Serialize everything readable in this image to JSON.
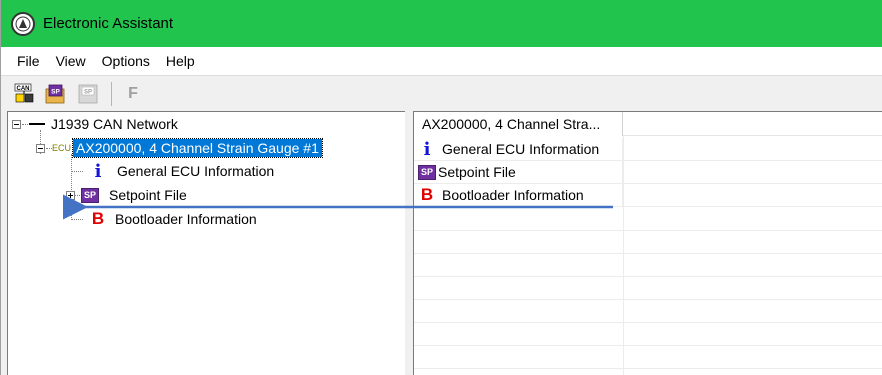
{
  "window": {
    "title": "Electronic Assistant",
    "accent_color": "#21c54e"
  },
  "menu": [
    {
      "label": "File"
    },
    {
      "label": "View"
    },
    {
      "label": "Options"
    },
    {
      "label": "Help"
    }
  ],
  "toolbar": {
    "can_icon_text": "CAN",
    "sp_icon_text": "SP",
    "f_label": "F"
  },
  "tree": {
    "root": {
      "label": "J1939 CAN Network"
    },
    "ecu": {
      "tag": "ECU",
      "label": "AX200000, 4 Channel Strain Gauge #1"
    },
    "children": [
      {
        "label": "General ECU Information",
        "icon": "info-icon",
        "icon_text": "i"
      },
      {
        "label": "Setpoint File",
        "icon": "setpoint-icon",
        "icon_text": "SP"
      },
      {
        "label": "Bootloader Information",
        "icon": "bootloader-icon",
        "icon_text": "B"
      }
    ]
  },
  "list": {
    "column_header": "AX200000, 4 Channel Stra...",
    "rows": [
      {
        "label": "General ECU Information",
        "icon": "info-icon",
        "icon_text": "i"
      },
      {
        "label": "Setpoint File",
        "icon": "setpoint-icon",
        "icon_text": "SP"
      },
      {
        "label": "Bootloader Information",
        "icon": "bootloader-icon",
        "icon_text": "B"
      }
    ]
  },
  "annotation": {
    "arrow_color": "#4472c4"
  }
}
